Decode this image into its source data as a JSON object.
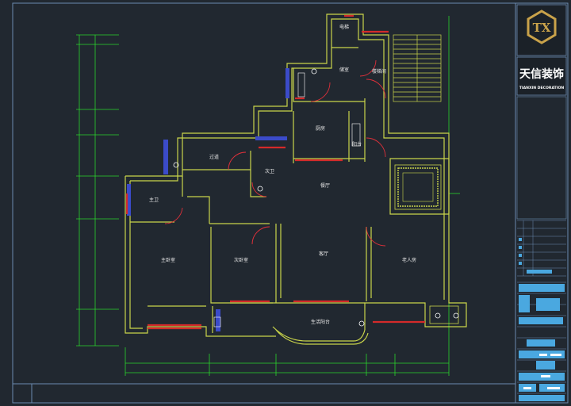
{
  "colors": {
    "background": "#212830",
    "wall": "#c9d44a",
    "window": "#d42a2a",
    "door": "#e0303a",
    "dimension": "#2bd42b",
    "frame": "#6a8ab0",
    "fixture": "#3b4bc9",
    "logo": "#c9a24a",
    "stamp": "#4aa8e0"
  },
  "title_block": {
    "logo_name": "tx-logo-icon",
    "logo_text": "TX",
    "company_cn": "天信装饰",
    "company_en": "TIANXIN DECORATION"
  },
  "rooms": {
    "hall_top": "电梯",
    "storage": "储室",
    "stair_landing": "楼梯间",
    "kitchen": "厨房",
    "corridor": "过道",
    "laundry": "阳台",
    "bath2": "次卫",
    "master_bath": "主卫",
    "dining": "餐厅",
    "master_bedroom": "主卧室",
    "second_bedroom": "次卧室",
    "living": "客厅",
    "elder_bedroom": "老人房",
    "balcony": "生活阳台"
  }
}
